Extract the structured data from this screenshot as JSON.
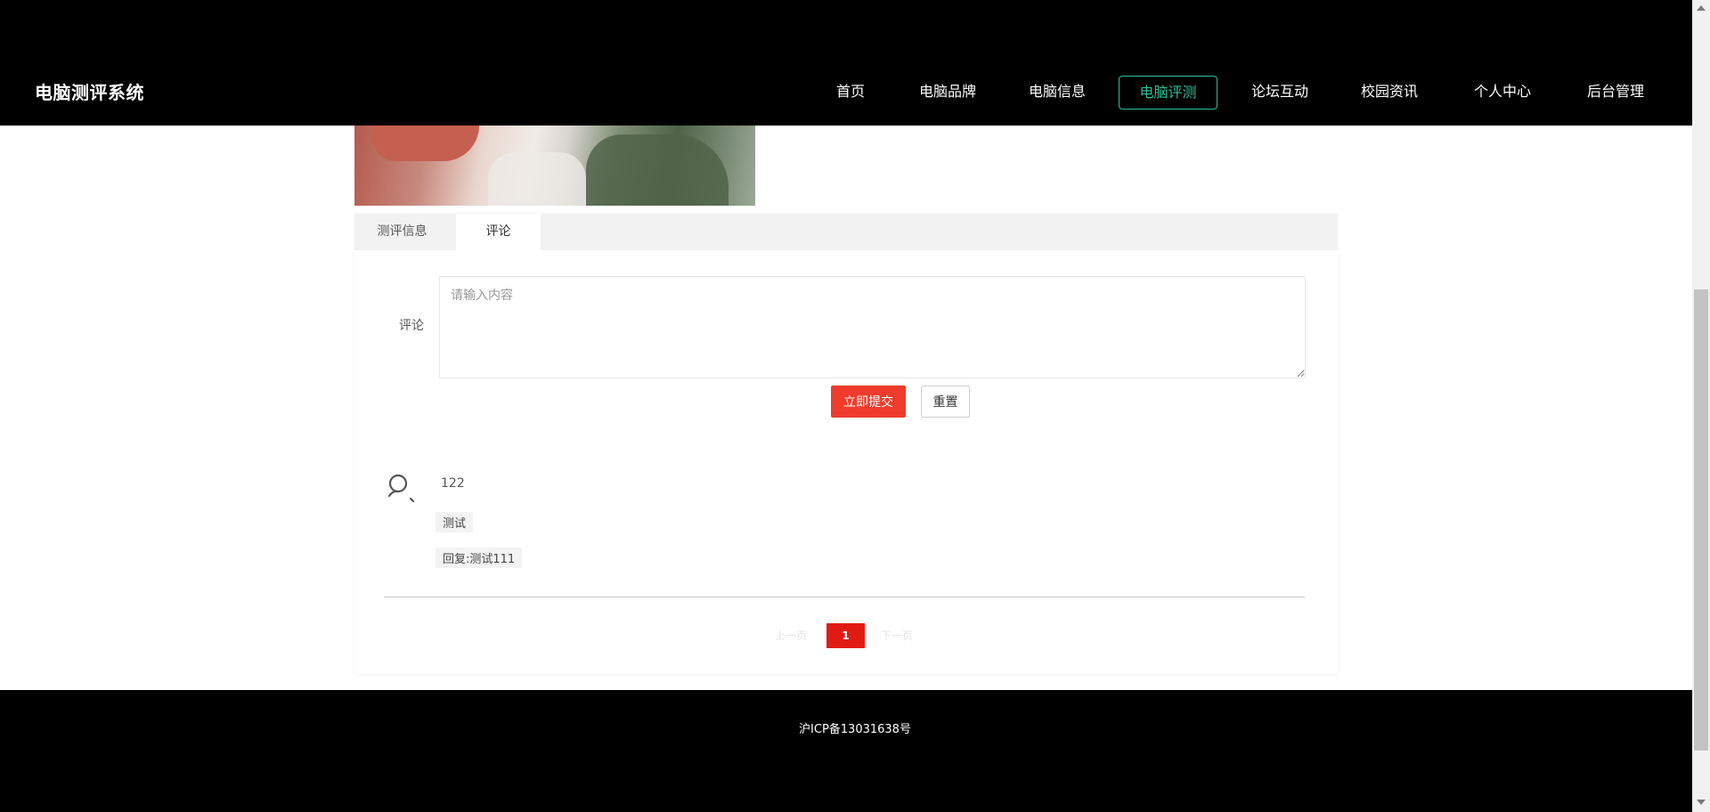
{
  "header": {
    "brand": "电脑测评系统",
    "nav": [
      {
        "label": "首页",
        "active": false
      },
      {
        "label": "电脑品牌",
        "active": false
      },
      {
        "label": "电脑信息",
        "active": false
      },
      {
        "label": "电脑评测",
        "active": true
      },
      {
        "label": "论坛互动",
        "active": false
      },
      {
        "label": "校园资讯",
        "active": false
      },
      {
        "label": "个人中心",
        "active": false
      },
      {
        "label": "后台管理",
        "active": false
      }
    ]
  },
  "tabs": [
    {
      "label": "测评信息",
      "active": false
    },
    {
      "label": "评论",
      "active": true
    }
  ],
  "comment_form": {
    "label": "评论",
    "placeholder": "请输入内容",
    "value": "",
    "submit_label": "立即提交",
    "reset_label": "重置"
  },
  "comments": [
    {
      "user": "122",
      "content": "测试",
      "reply": "回复:测试111"
    }
  ],
  "pagination": {
    "prev_label": "上一页",
    "current_page": "1",
    "next_label": "下一页"
  },
  "footer": {
    "icp": "沪ICP备13031638号"
  },
  "colors": {
    "header_bg": "#000000",
    "active_nav": "#2fbf9b",
    "submit_button": "#ee3b2c",
    "current_page": "#e11b14"
  },
  "icons": {
    "avatar": "user-search-icon"
  }
}
